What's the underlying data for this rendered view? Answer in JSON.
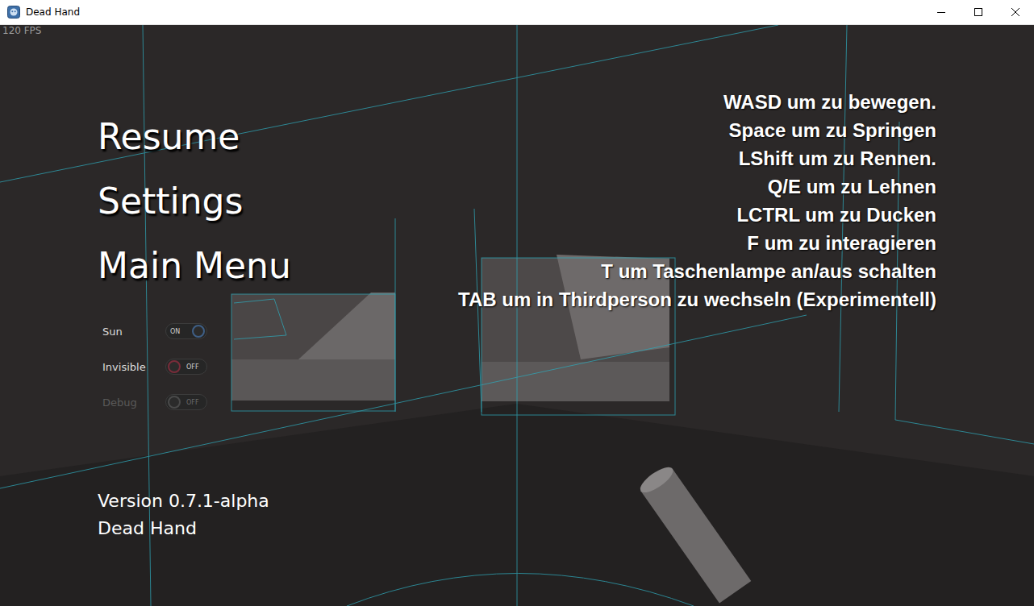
{
  "window": {
    "title": "Dead Hand"
  },
  "fps": "120 FPS",
  "menu": [
    {
      "label": "Resume"
    },
    {
      "label": "Settings"
    },
    {
      "label": "Main Menu"
    }
  ],
  "toggles": [
    {
      "label": "Sun",
      "on": true,
      "state_text": "ON",
      "disabled": false
    },
    {
      "label": "Invisible",
      "on": false,
      "state_text": "OFF",
      "disabled": false
    },
    {
      "label": "Debug",
      "on": false,
      "state_text": "OFF",
      "disabled": true
    }
  ],
  "controls_help": [
    "WASD um zu bewegen.",
    "Space um zu Springen",
    "LShift um zu Rennen.",
    "Q/E um zu Lehnen",
    "LCTRL um zu Ducken",
    "F um zu interagieren",
    "T um Taschenlampe an/aus schalten",
    "TAB um in Thirdperson zu wechseln (Experimentell)"
  ],
  "version": "Version 0.7.1-alpha",
  "game_name": "Dead Hand"
}
